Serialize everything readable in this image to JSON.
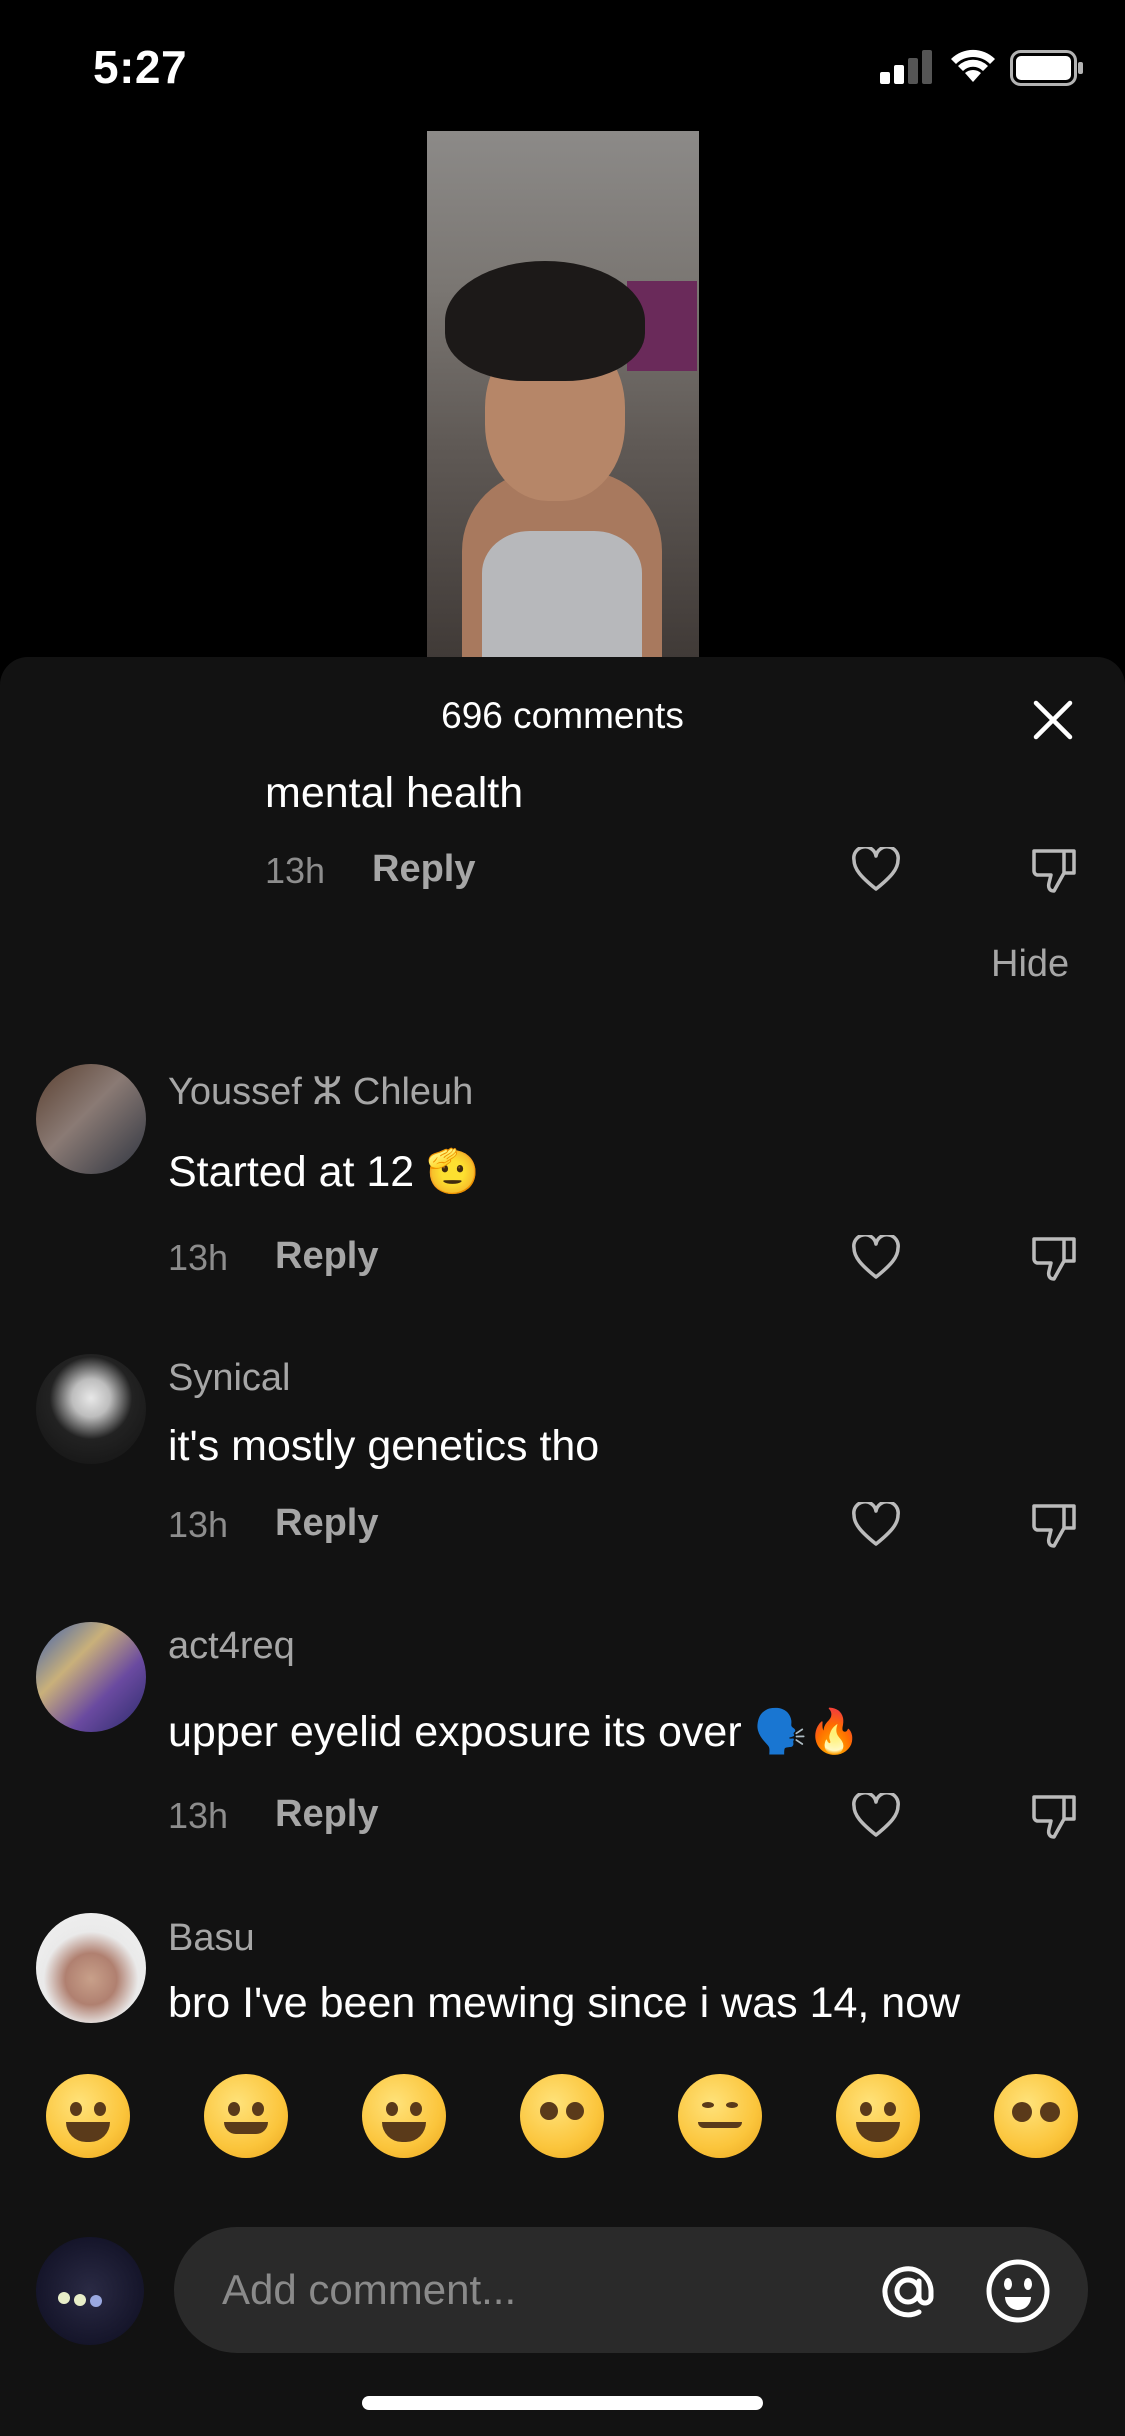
{
  "status_bar": {
    "time": "5:27"
  },
  "sheet": {
    "title": "696 comments",
    "hide_label": "Hide"
  },
  "comments": [
    {
      "text": "mental health",
      "time": "13h",
      "reply": "Reply"
    },
    {
      "username": "Youssef ⵣ Chleuh",
      "text": "Started at 12 🫡",
      "time": "13h",
      "reply": "Reply"
    },
    {
      "username": "Synical",
      "text": "it's mostly genetics tho",
      "time": "13h",
      "reply": "Reply"
    },
    {
      "username": "act4req",
      "text": "upper eyelid exposure its over 🗣️🔥",
      "time": "13h",
      "reply": "Reply"
    },
    {
      "username": "Basu",
      "text": "bro I've been mewing since i was 14, now"
    }
  ],
  "emoji_bar": [
    "grinning-face",
    "smiling-face-with-hearts",
    "tears-of-joy",
    "flushed-face",
    "smirking-face",
    "grinning-sweat",
    "pleading-face"
  ],
  "input": {
    "placeholder": "Add comment..."
  },
  "colors": {
    "sheet_bg": "#121212",
    "input_bg": "#2a2a2a",
    "muted_text": "#a6a6a6"
  }
}
